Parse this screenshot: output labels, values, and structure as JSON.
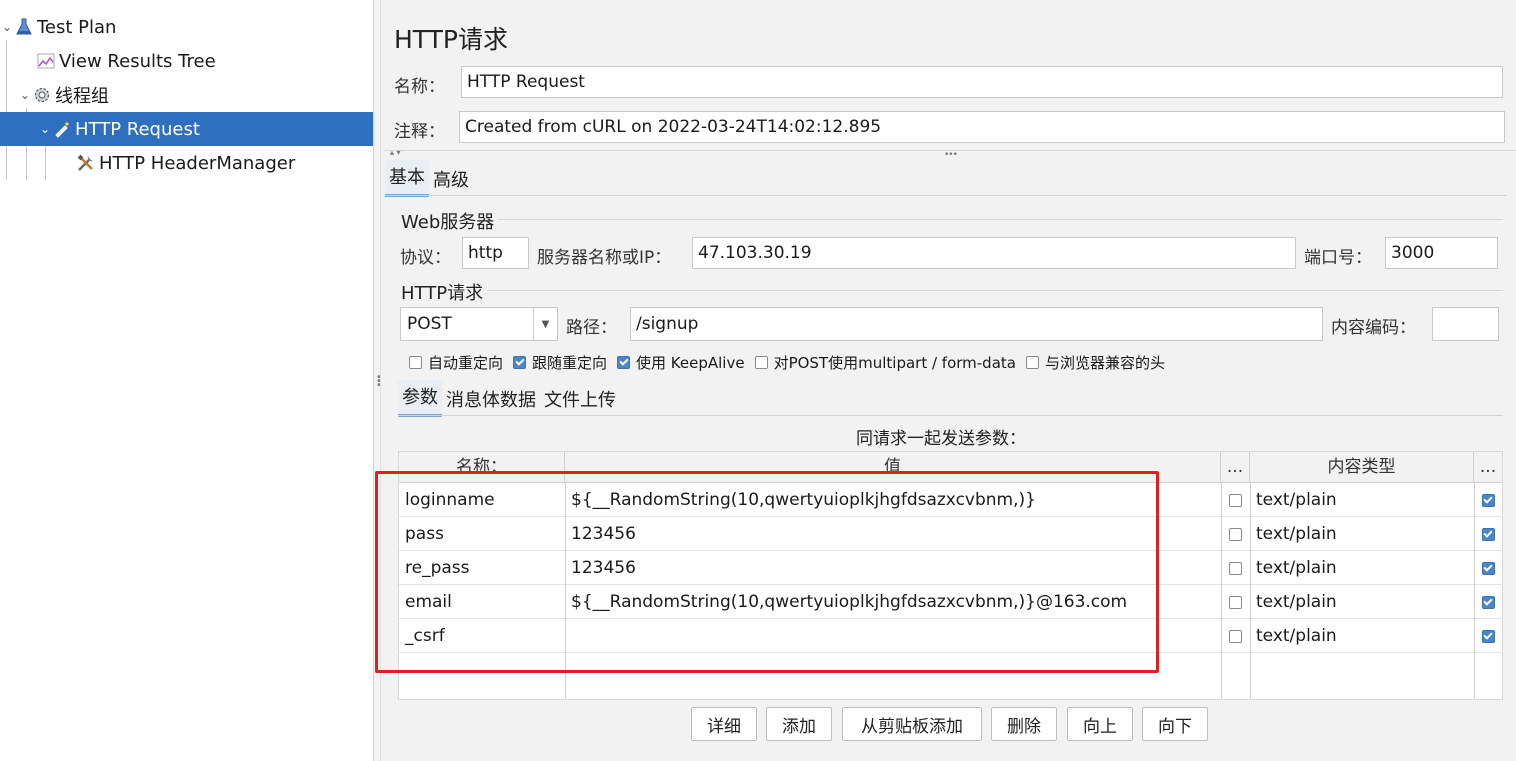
{
  "tree": {
    "items": [
      {
        "label": "Test Plan",
        "icon": "flask-icon"
      },
      {
        "label": "View Results Tree",
        "icon": "chart-icon"
      },
      {
        "label": "线程组",
        "icon": "gear-icon"
      },
      {
        "label": "HTTP Request",
        "icon": "pipette-icon"
      },
      {
        "label": "HTTP HeaderManager",
        "icon": "tools-icon"
      }
    ]
  },
  "panel": {
    "title": "HTTP请求",
    "name_label": "名称：",
    "name_value": "HTTP Request",
    "comment_label": "注释：",
    "comment_value": "Created from cURL on 2022-03-24T14:02:12.895"
  },
  "tabs": {
    "basic": "基本",
    "advanced": "高级"
  },
  "web_server": {
    "section": "Web服务器",
    "protocol_label": "协议：",
    "protocol_value": "http",
    "server_label": "服务器名称或IP：",
    "server_value": "47.103.30.19",
    "port_label": "端口号：",
    "port_value": "3000"
  },
  "http_request": {
    "section": "HTTP请求",
    "method": "POST",
    "path_label": "路径：",
    "path_value": "/signup",
    "encoding_label": "内容编码：",
    "encoding_value": ""
  },
  "options": [
    {
      "label": "自动重定向",
      "checked": false
    },
    {
      "label": "跟随重定向",
      "checked": true
    },
    {
      "label": "使用 KeepAlive",
      "checked": true
    },
    {
      "label": "对POST使用multipart / form-data",
      "checked": false
    },
    {
      "label": "与浏览器兼容的头",
      "checked": false
    }
  ],
  "subtabs": {
    "params": "参数",
    "body": "消息体数据",
    "files": "文件上传"
  },
  "params_caption": "同请求一起发送参数：",
  "table": {
    "headers": {
      "name": "名称：",
      "value": "值",
      "encode": "...",
      "content_type": "内容类型",
      "include": "..."
    },
    "rows": [
      {
        "name": "loginname",
        "value": "${__RandomString(10,qwertyuioplkjhgfdsazxcvbnm,)}",
        "encoded": false,
        "content_type": "text/plain",
        "include": true
      },
      {
        "name": "pass",
        "value": "123456",
        "encoded": false,
        "content_type": "text/plain",
        "include": true
      },
      {
        "name": "re_pass",
        "value": "123456",
        "encoded": false,
        "content_type": "text/plain",
        "include": true
      },
      {
        "name": "email",
        "value": "${__RandomString(10,qwertyuioplkjhgfdsazxcvbnm,)}@163.com",
        "encoded": false,
        "content_type": "text/plain",
        "include": true
      },
      {
        "name": "_csrf",
        "value": "",
        "encoded": false,
        "content_type": "text/plain",
        "include": true
      }
    ]
  },
  "buttons": {
    "detail": "详细",
    "add": "添加",
    "add_clipboard": "从剪贴板添加",
    "delete": "删除",
    "up": "向上",
    "down": "向下"
  },
  "colors": {
    "selection": "#2f6fbf",
    "highlight": "#e0201f",
    "checkbox": "#4a86c8"
  }
}
